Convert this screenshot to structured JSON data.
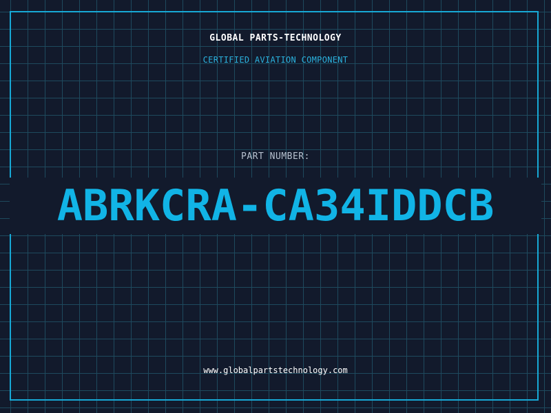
{
  "header": {
    "company_name": "GLOBAL PARTS-TECHNOLOGY",
    "tagline": "CERTIFIED AVIATION COMPONENT"
  },
  "part": {
    "label": "PART NUMBER:",
    "number": "ABRKCRA-CA34IDDCB"
  },
  "footer": {
    "website": "www.globalpartstechnology.com"
  },
  "colors": {
    "background": "#121a2c",
    "grid": "#1e4a5e",
    "accent": "#17a9d6",
    "part_number": "#11b4e6",
    "text": "#ffffff"
  }
}
